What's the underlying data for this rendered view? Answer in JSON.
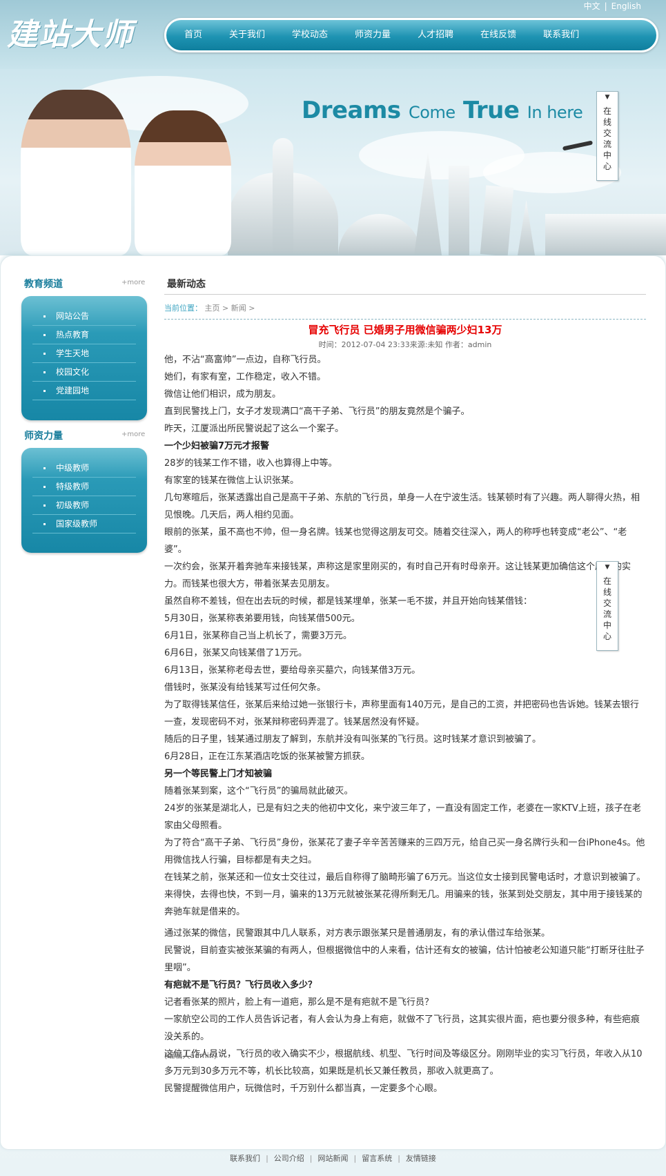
{
  "header": {
    "logo": "建站大师",
    "lang": [
      "中文",
      "English"
    ],
    "nav": [
      "首页",
      "关于我们",
      "学校动态",
      "师资力量",
      "人才招聘",
      "在线反馈",
      "联系我们"
    ]
  },
  "banner": {
    "slogan_1": "Dreams",
    "slogan_2": "Come",
    "slogan_3": "True",
    "slogan_4": "In here"
  },
  "float_service": {
    "label": "在线交流中心"
  },
  "sidebar": {
    "sections": [
      {
        "title": "教育频道",
        "more": "+more",
        "items": [
          "网站公告",
          "热点教育",
          "学生天地",
          "校园文化",
          "党建园地"
        ]
      },
      {
        "title": "师资力量",
        "more": "+more",
        "items": [
          "中级教师",
          "特级教师",
          "初级教师",
          "国家级教师"
        ]
      }
    ]
  },
  "content": {
    "title": "最新动态",
    "breadcrumb": {
      "label": "当前位置：",
      "path": "主页 > 新闻 >"
    },
    "article": {
      "title": "冒充飞行员 已婚男子用微信骗两少妇13万",
      "meta": "时间：2012-07-04 23:33来源:未知 作者：admin",
      "paragraphs": [
        "他，不沾“高富帅”一点边，自称飞行员。",
        "她们，有家有室，工作稳定，收入不错。",
        "微信让他们相识，成为朋友。",
        "直到民警找上门，女子才发现满口“高干子弟、飞行员”的朋友竟然是个骗子。",
        "昨天，江厦派出所民警说起了这么一个案子。",
        "一个少妇被骗7万元才报警",
        "28岁的钱某工作不错，收入也算得上中等。",
        "有家室的钱某在微信上认识张某。",
        "几句寒暄后，张某透露出自己是高干子弟、东航的飞行员，单身一人在宁波生活。钱某顿时有了兴趣。两人聊得火热，相见恨晚。几天后，两人相约见面。",
        "眼前的张某，虽不高也不帅，但一身名牌。钱某也觉得这朋友可交。随着交往深入，两人的称呼也转变成“老公”、“老婆”。",
        "一次约会，张某开着奔驰车来接钱某，声称这是家里刚买的，有时自己开有时母亲开。这让钱某更加确信这个朋友的实力。而钱某也很大方，带着张某去见朋友。",
        "虽然自称不差钱，但在出去玩的时候，都是钱某埋单，张某一毛不拔，并且开始向钱某借钱：",
        "5月30日，张某称表弟要用钱，向钱某借500元。",
        "6月1日，张某称自己当上机长了，需要3万元。",
        "6月6日，张某又向钱某借了1万元。",
        "6月13日，张某称老母去世，要给母亲买墓穴，向钱某借3万元。",
        "借钱时，张某没有给钱某写过任何欠条。",
        "为了取得钱某信任，张某后来给过她一张银行卡，声称里面有140万元，是自己的工资，并把密码也告诉她。钱某去银行一查，发现密码不对，张某辩称密码弄混了。钱某居然没有怀疑。",
        "随后的日子里，钱某通过朋友了解到，东航并没有叫张某的飞行员。这时钱某才意识到被骗了。",
        "6月28日，正在江东某酒店吃饭的张某被警方抓获。",
        "另一个等民警上门才知被骗",
        "随着张某到案，这个“飞行员”的骗局就此破灭。",
        "24岁的张某是湖北人，已是有妇之夫的他初中文化，来宁波三年了，一直没有固定工作，老婆在一家KTV上班，孩子在老家由父母照看。",
        "为了符合“高干子弟、飞行员”身份，张某花了妻子辛辛苦苦赚来的三四万元，给自己买一身名牌行头和一台iPhone4s。他用微信找人行骗，目标都是有夫之妇。",
        "在钱某之前，张某还和一位女士交往过，最后自称得了脑畸形骗了6万元。当这位女士接到民警电话时，才意识到被骗了。",
        "来得快，去得也快，不到一月，骗来的13万元就被张某花得所剩无几。用骗来的钱，张某到处交朋友，其中用于接钱某的奔驰车就是借来的。",
        "通过张某的微信，民警跟其中几人联系，对方表示跟张某只是普通朋友，有的承认借过车给张某。",
        "民警说，目前查实被张某骗的有两人，但根据微信中的人来看，估计还有女的被骗，估计怕被老公知道只能“打断牙往肚子里咽”。",
        "有疤就不是飞行员？飞行员收入多少？",
        "记者看张某的照片，脸上有一道疤，那么是不是有疤就不是飞行员？",
        "一家航空公司的工作人员告诉记者，有人会认为身上有疤，就做不了飞行员，这其实很片面，疤也要分很多种，有些疤痕没关系的。",
        "这位工作人员说，飞行员的收入确实不少，根据航线、机型、飞行时间及等级区分。刚刚毕业的实习飞行员，年收入从10多万元到30多万元不等，机长比较高，如果既是机长又兼任教员，那收入就更高了。",
        "民警提醒微信用户，玩微信时，千万别什么都当真，一定要多个心眼。"
      ],
      "editor": "(编辑人admin)"
    }
  },
  "footer": [
    "联系我们",
    "公司介绍",
    "网站新闻",
    "留言系统",
    "友情链接"
  ]
}
